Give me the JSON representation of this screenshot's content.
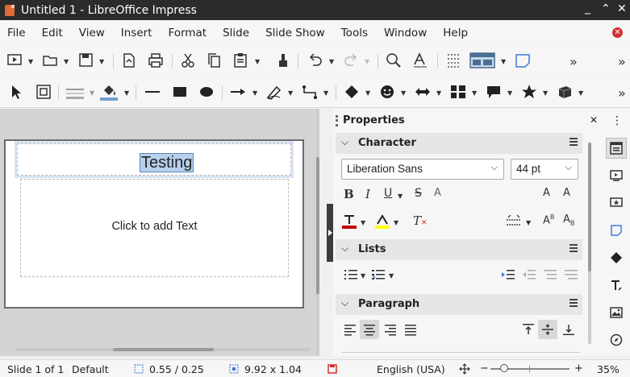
{
  "window": {
    "title": "Untitled 1 - LibreOffice Impress",
    "minimize": "_",
    "maximize": "⌃",
    "close": "✕"
  },
  "menu": [
    "File",
    "Edit",
    "View",
    "Insert",
    "Format",
    "Slide",
    "Slide Show",
    "Tools",
    "Window",
    "Help"
  ],
  "slide": {
    "title_text": "Testing",
    "content_placeholder": "Click to add Text"
  },
  "sidebar": {
    "title": "Properties",
    "character": {
      "header": "Character",
      "font_name": "Liberation Sans",
      "font_size": "44 pt",
      "bold": "B",
      "italic": "I",
      "underline": "U",
      "strike": "S",
      "shadow": "A",
      "grow": "A",
      "shrink": "A",
      "clear": "T"
    },
    "lists": {
      "header": "Lists"
    },
    "paragraph": {
      "header": "Paragraph"
    }
  },
  "statusbar": {
    "slide_info": "Slide 1 of 1",
    "layout": "Default",
    "position": "0.55 / 0.25",
    "size": "9.92 x 1.04",
    "language": "English (USA)",
    "zoom_minus": "−",
    "zoom_plus": "+",
    "zoom": "35%"
  },
  "icons": {
    "toolbar1": [
      "new-slide-icon",
      "open-icon",
      "save-icon",
      "export-pdf-icon",
      "print-icon",
      "cut-icon",
      "copy-icon",
      "paste-icon",
      "clone-formatting-icon",
      "undo-icon",
      "redo-icon",
      "find-icon",
      "spelling-icon",
      "grid-icon",
      "display-views-icon",
      "comment-icon"
    ],
    "toolbar2": [
      "select-icon",
      "zoom-pan-icon",
      "line-color-icon",
      "fill-color-icon",
      "line-icon",
      "rectangle-icon",
      "ellipse-icon",
      "arrow-icon",
      "curve-icon",
      "connector-icon",
      "basic-shapes-icon",
      "symbol-shapes-icon",
      "block-arrows-icon",
      "flowchart-icon",
      "callout-icon",
      "stars-icon",
      "3d-objects-icon"
    ]
  },
  "colors": {
    "title_bar": "#2b2b2b",
    "selection": "#b6d0ed",
    "font_color": "#c00000",
    "highlight": "#ffff00",
    "fill_color": "#729fcf"
  }
}
